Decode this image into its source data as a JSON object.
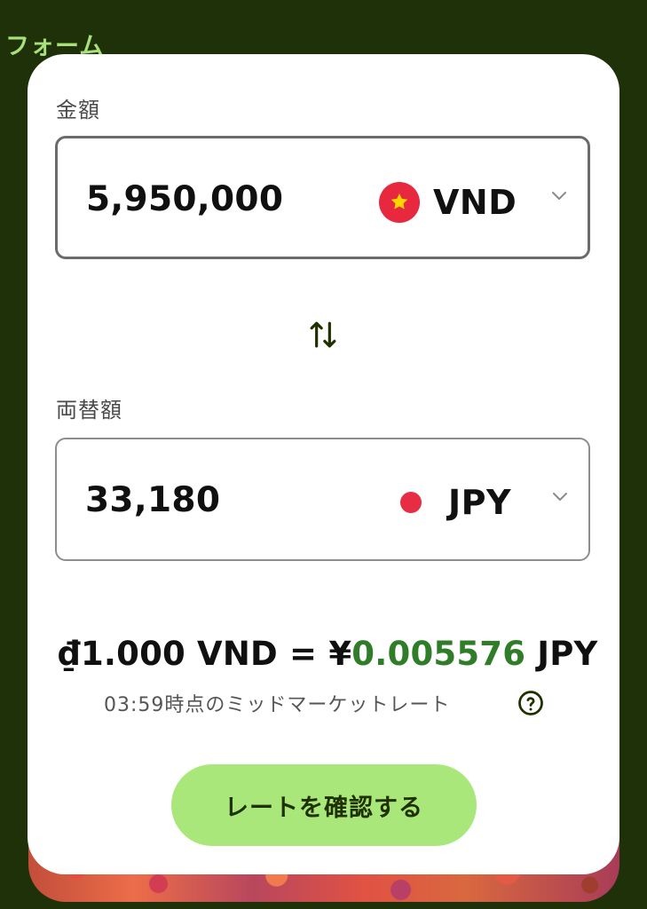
{
  "header": {
    "form_label": "フォーム"
  },
  "amount": {
    "label": "金額",
    "value": "5,950,000",
    "currency": "VND",
    "flag_icon": "vietnam-flag-icon"
  },
  "converted": {
    "label": "両替額",
    "value": "33,180",
    "currency": "JPY",
    "flag_icon": "japan-flag-icon"
  },
  "rate": {
    "prefix": "₫1.000 VND = ¥",
    "value": "0.005576",
    "suffix": " JPY",
    "note": "03:59時点のミッドマーケットレート"
  },
  "actions": {
    "confirm_label": "レートを確認する"
  },
  "colors": {
    "background": "#1f3109",
    "accent": "#a9e77a",
    "rate_highlight": "#2f7d28"
  }
}
